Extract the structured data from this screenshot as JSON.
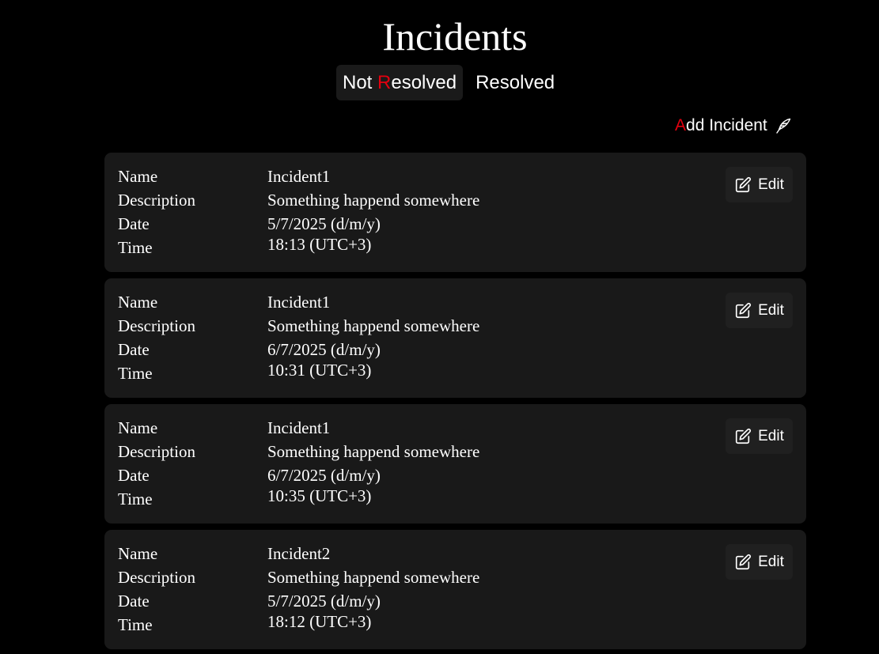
{
  "page": {
    "title": "Incidents"
  },
  "tabs": [
    {
      "prefix": "Not ",
      "accent": "R",
      "rest": "esolved",
      "active": true
    },
    {
      "label": "Resolved",
      "active": false
    }
  ],
  "add_incident": {
    "accent": "A",
    "rest": "dd Incident",
    "icon": "feather-pen-icon"
  },
  "labels": {
    "name": "Name",
    "description": "Description",
    "date": "Date",
    "time": "Time",
    "edit": "Edit"
  },
  "incidents": [
    {
      "name": "Incident1",
      "description": "Something happend somewhere",
      "date": "5/7/2025 (d/m/y)",
      "time": "18:13 (UTC+3)"
    },
    {
      "name": "Incident1",
      "description": "Something happend somewhere",
      "date": "6/7/2025 (d/m/y)",
      "time": "10:31 (UTC+3)"
    },
    {
      "name": "Incident1",
      "description": "Something happend somewhere",
      "date": "6/7/2025 (d/m/y)",
      "time": "10:35 (UTC+3)"
    },
    {
      "name": "Incident2",
      "description": "Something happend somewhere",
      "date": "5/7/2025 (d/m/y)",
      "time": "18:12 (UTC+3)"
    }
  ],
  "colors": {
    "background": "#000000",
    "card": "#191919",
    "accent": "#e3000f",
    "text": "#ffffff"
  }
}
